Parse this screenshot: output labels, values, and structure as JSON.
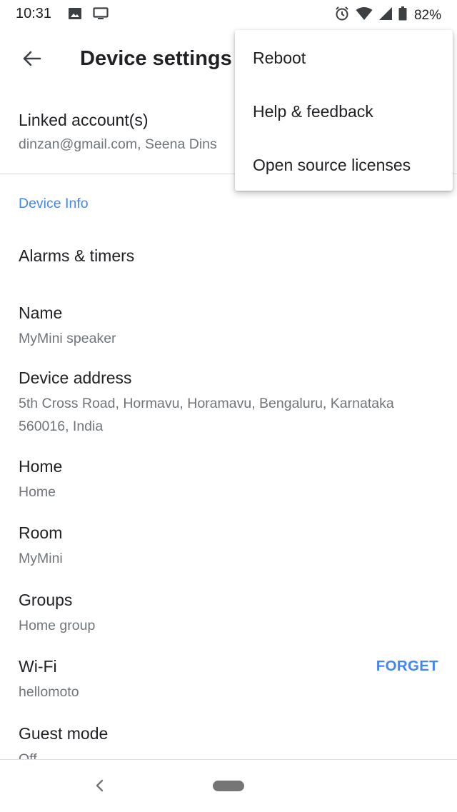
{
  "status_bar": {
    "time": "10:31",
    "left_icons": [
      "image-icon",
      "cast-icon"
    ],
    "right_icons": [
      "alarm-icon",
      "wifi-icon",
      "signal-icon",
      "battery-icon"
    ],
    "battery": "82%"
  },
  "app_bar": {
    "title": "Device settings"
  },
  "linked_account": {
    "title": "Linked account(s)",
    "subtitle": "dinzan@gmail.com, Seena Dins"
  },
  "section": {
    "header": "Device Info"
  },
  "items": {
    "alarms": {
      "title": "Alarms & timers"
    },
    "name": {
      "title": "Name",
      "subtitle": "MyMini speaker"
    },
    "address": {
      "title": "Device address",
      "subtitle_line1": "5th Cross Road, Hormavu, Horamavu, Bengaluru, Karnataka",
      "subtitle_line2": "560016, India"
    },
    "home": {
      "title": "Home",
      "subtitle": "Home"
    },
    "room": {
      "title": "Room",
      "subtitle": "MyMini"
    },
    "groups": {
      "title": "Groups",
      "subtitle": "Home group"
    },
    "wifi": {
      "title": "Wi-Fi",
      "subtitle": "hellomoto",
      "action": "FORGET"
    },
    "guest": {
      "title": "Guest mode",
      "subtitle": "Off"
    }
  },
  "overflow_menu": {
    "items": [
      "Reboot",
      "Help & feedback",
      "Open source licenses"
    ]
  },
  "colors": {
    "accent": "#4285f4",
    "primary_text": "#202124",
    "secondary_text": "#70757a"
  }
}
